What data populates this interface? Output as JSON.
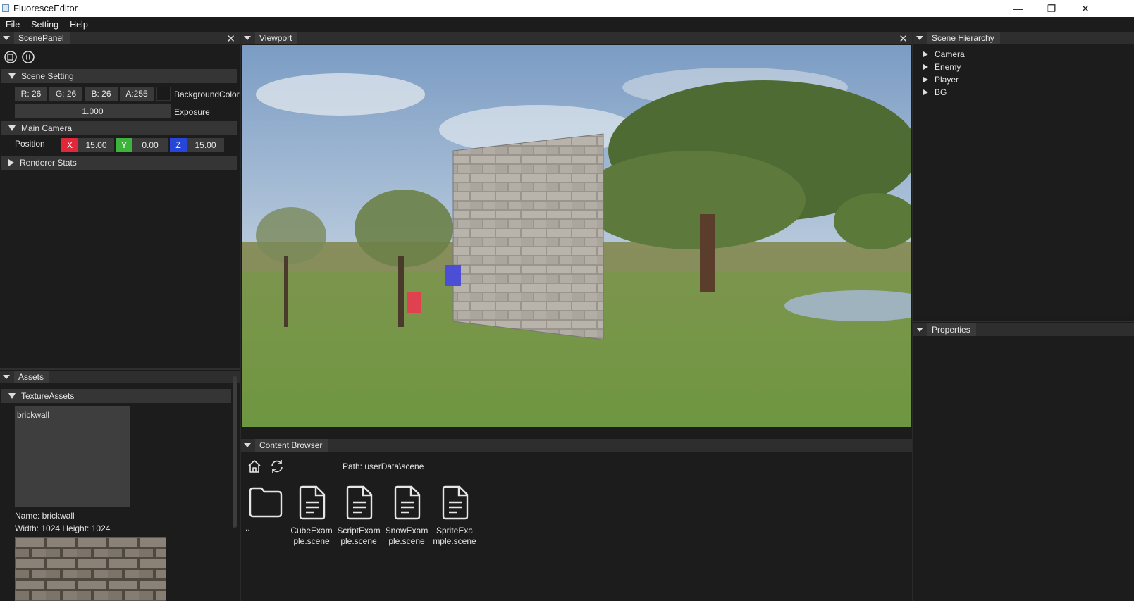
{
  "window": {
    "title": "FluoresceEditor",
    "minimize": "—",
    "restore": "❐",
    "close": "✕"
  },
  "menu": [
    "File",
    "Setting",
    "Help"
  ],
  "scene_panel": {
    "tab": "ScenePanel",
    "scene_setting": {
      "header": "Scene Setting",
      "r": "R: 26",
      "g": "G: 26",
      "b": "B: 26",
      "a": "A:255",
      "bg_label": "BackgroundColor",
      "exposure_value": "1.000",
      "exposure_label": "Exposure"
    },
    "main_camera": {
      "header": "Main Camera",
      "position_label": "Position",
      "x_label": "X",
      "x": "15.00",
      "y_label": "Y",
      "y": "0.00",
      "z_label": "Z",
      "z": "15.00"
    },
    "renderer_stats": {
      "header": "Renderer Stats"
    }
  },
  "viewport": {
    "tab": "Viewport"
  },
  "scene_hierarchy": {
    "tab": "Scene Hierarchy",
    "items": [
      "Camera",
      "Enemy",
      "Player",
      "BG"
    ]
  },
  "properties": {
    "tab": "Properties"
  },
  "assets": {
    "tab": "Assets",
    "texture_header": "TextureAssets",
    "card_name": "brickwall",
    "name_line": "Name: brickwall",
    "size_line": "Width: 1024  Height: 1024"
  },
  "content_browser": {
    "tab": "Content Browser",
    "path": "Path: userData\\scene",
    "files": [
      {
        "name": "..",
        "icon": "folder-icon"
      },
      {
        "name": "CubeExample.scene",
        "icon": "file-icon"
      },
      {
        "name": "ScriptExample.scene",
        "icon": "file-icon"
      },
      {
        "name": "SnowExample.scene",
        "icon": "file-icon"
      },
      {
        "name": "SpriteExample.scene",
        "icon": "file-icon"
      }
    ]
  },
  "colors": {
    "x_axis": "#e0283a",
    "y_axis": "#3cb43c",
    "z_axis": "#2546d8",
    "enemy_cube": "#e0414f",
    "player_cube": "#4b4fd6"
  }
}
